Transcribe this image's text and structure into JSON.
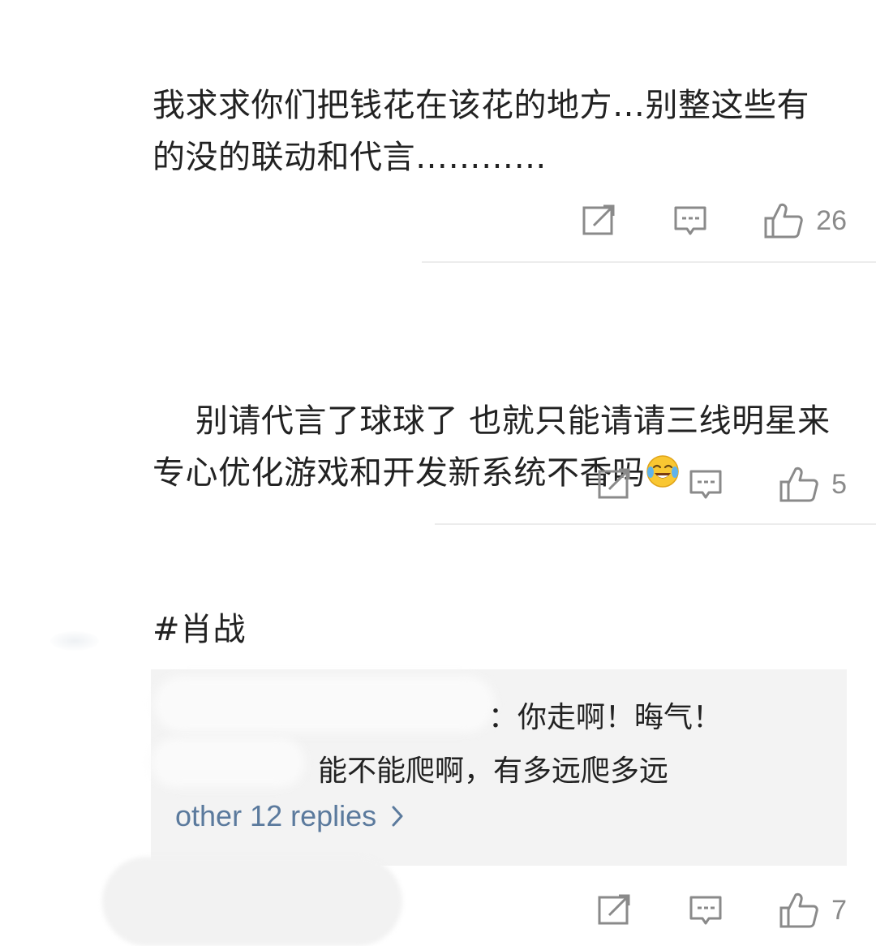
{
  "comments": [
    {
      "text": "我求求你们把钱花在该花的地方…别整这些有的没的联动和代言…………",
      "like_count": "26"
    },
    {
      "text": "别请代言了球球了 也就只能请请三线明星来 专心优化游戏和开发新系统不香吗",
      "emoji": "crying-laughing-emoji",
      "like_count": "5"
    },
    {
      "text": "#肖战",
      "replies": [
        {
          "text": "：你走啊！晦气！"
        },
        {
          "text": "能不能爬啊，有多远爬多远"
        }
      ],
      "more_replies_label": "other 12 replies",
      "like_count": "7"
    }
  ],
  "icons": {
    "share": "share-icon",
    "comment": "comment-icon",
    "like": "thumbs-up-icon",
    "more": "chevron-right-icon"
  },
  "colors": {
    "text": "#222222",
    "muted": "#8a8a8a",
    "link": "#5b7a9d",
    "reply_bg": "#f3f3f3",
    "divider": "#ececec"
  }
}
